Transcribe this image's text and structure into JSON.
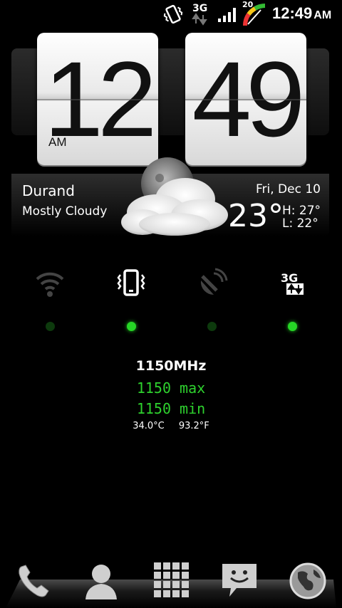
{
  "status_bar": {
    "battery_percent": "20",
    "time": "12:49",
    "ampm": "AM",
    "network_type": "3G",
    "icons": [
      "vibrate-icon",
      "3g-data-icon",
      "signal-icon",
      "battery-gauge-icon"
    ]
  },
  "clock": {
    "hours": "12",
    "minutes": "49",
    "ampm": "AM"
  },
  "weather": {
    "city": "Durand",
    "condition": "Mostly Cloudy",
    "date": "Fri, Dec 10",
    "temperature": "23°",
    "high": "H:  27°",
    "low": "L:  22°",
    "icon": "cloudy-night-icon"
  },
  "toggles": [
    {
      "name": "wifi",
      "icon": "wifi-icon",
      "on": false
    },
    {
      "name": "vibrate",
      "icon": "vibrate-icon",
      "on": true
    },
    {
      "name": "gps",
      "icon": "gps-icon",
      "on": false
    },
    {
      "name": "mobile-data",
      "icon": "3g-data-icon",
      "on": true
    }
  ],
  "cpu": {
    "frequency": "1150MHz",
    "max": "1150 max",
    "min": "1150 min",
    "temp_c": "34.0°C",
    "temp_f": "93.2°F"
  },
  "dock": {
    "icons": [
      "phone-icon",
      "contacts-icon",
      "app-drawer-icon",
      "messages-icon",
      "browser-icon"
    ]
  },
  "colors": {
    "accent_green": "#2ed12e",
    "background": "#000000"
  }
}
